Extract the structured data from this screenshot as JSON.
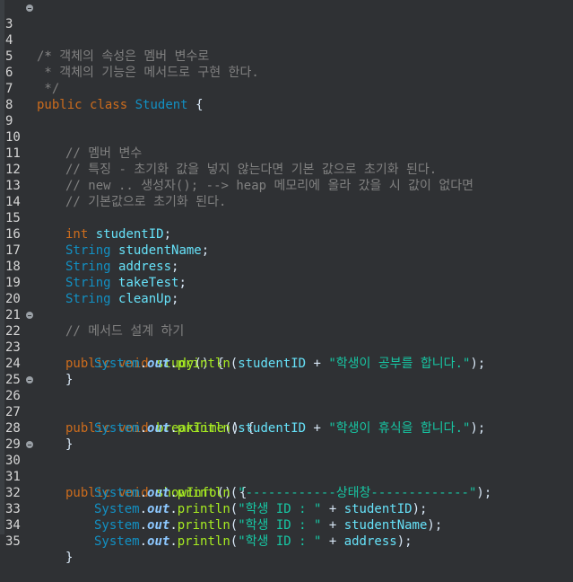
{
  "lines": [
    {
      "n": "3",
      "fold": true
    },
    {
      "n": "4",
      "comment": " * 객체의 속성은 멤버 변수로"
    },
    {
      "n": "5",
      "comment": " * 객체의 기능은 메서드로 구현 한다."
    },
    {
      "n": "6",
      "comment": " */"
    },
    {
      "n": "7",
      "kw1": "public",
      "kw2": "class",
      "cls": "Student",
      "brace": "{"
    },
    {
      "n": "8"
    },
    {
      "n": "9"
    },
    {
      "n": "10",
      "comment": "// 멤버 변수"
    },
    {
      "n": "11",
      "comment": "// 특징 - 초기화 값을 넣지 않는다면 기본 값으로 초기화 된다."
    },
    {
      "n": "12",
      "comment": "// new .. 생성자(); --> heap 메모리에 올라 갔을 시 값이 없다면"
    },
    {
      "n": "13",
      "comment": "// 기본값으로 초기화 된다."
    },
    {
      "n": "14"
    },
    {
      "n": "15",
      "type": "int",
      "field": "studentID",
      "semi": ";"
    },
    {
      "n": "16",
      "type": "String",
      "field": "studentName",
      "semi": ";"
    },
    {
      "n": "17",
      "type": "String",
      "field": "address",
      "semi": ";"
    },
    {
      "n": "18",
      "type": "String",
      "field": "takeTest",
      "semi": ";"
    },
    {
      "n": "19",
      "type": "String",
      "field": "cleanUp",
      "semi": ";"
    },
    {
      "n": "20"
    },
    {
      "n": "21",
      "comment": "// 메서드 설계 하기"
    },
    {
      "n": "22",
      "fold": true,
      "kw1": "public",
      "kw2": "void",
      "method": "study",
      "sig": "() {"
    },
    {
      "n": "23",
      "sys": "System",
      "dot1": ".",
      "out": "out",
      "dot2": ".",
      "println": "println",
      "open": "(",
      "arg": "studentID",
      "plus": " + ",
      "str": "\"학생이 공부를 합니다.\"",
      "close": ");"
    },
    {
      "n": "24",
      "brace": "}"
    },
    {
      "n": "25"
    },
    {
      "n": "26",
      "fold": true,
      "kw1": "public",
      "kw2": "void",
      "method": "breakTime",
      "sig": "() {"
    },
    {
      "n": "27",
      "sys": "System",
      "dot1": ".",
      "out": "out",
      "dot2": ".",
      "println": "println",
      "open": "(",
      "arg": "studentID",
      "plus": " + ",
      "str": "\"학생이 휴식을 합니다.\"",
      "close": ");"
    },
    {
      "n": "28",
      "brace": "}"
    },
    {
      "n": "29"
    },
    {
      "n": "30",
      "fold": true,
      "kw1": "public",
      "kw2": "void",
      "method": "showInfo",
      "sig": "() {"
    },
    {
      "n": "31",
      "sys": "System",
      "dot1": ".",
      "out": "out",
      "dot2": ".",
      "println": "println",
      "open": "(",
      "str": "\"------------상태창-------------\"",
      "close": ");"
    },
    {
      "n": "32",
      "sys": "System",
      "dot1": ".",
      "out": "out",
      "dot2": ".",
      "println": "println",
      "open": "(",
      "str": "\"학생 ID : \"",
      "plus": " + ",
      "arg": "studentID",
      "close": ");"
    },
    {
      "n": "33",
      "sys": "System",
      "dot1": ".",
      "out": "out",
      "dot2": ".",
      "println": "println",
      "open": "(",
      "str": "\"학생 ID : \"",
      "plus": " + ",
      "arg": "studentName",
      "close": ");"
    },
    {
      "n": "34",
      "sys": "System",
      "dot1": ".",
      "out": "out",
      "dot2": ".",
      "println": "println",
      "open": "(",
      "str": "\"학생 ID : \"",
      "plus": " + ",
      "arg": "address",
      "close": ");"
    },
    {
      "n": "35",
      "brace": "}"
    }
  ],
  "first_line_comment": "/*",
  "colors": {
    "background": "#2f3134",
    "keyword": "#cc6c1d",
    "type": "#1290c3",
    "comment": "#808080",
    "field": "#66e1f8",
    "method": "#a7ec21",
    "string": "#17c6a3",
    "static": "#8dc8ff",
    "plain": "#d9e8f7"
  },
  "icons": [
    "fold-collapse-icon"
  ]
}
